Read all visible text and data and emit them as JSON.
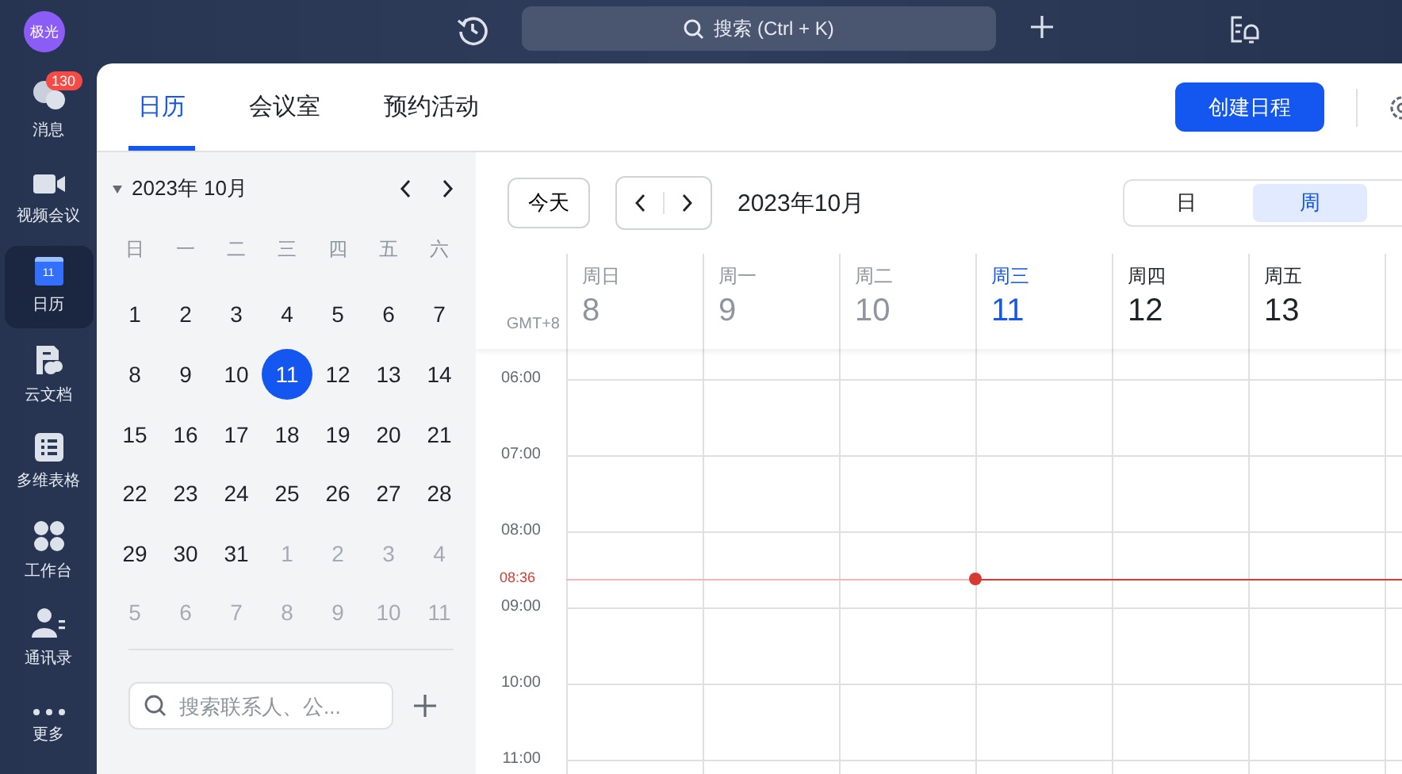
{
  "top_bar": {
    "avatar": "极光",
    "search": {
      "placeholder": "搜索 (Ctrl + K)"
    }
  },
  "rail": [
    {
      "kind": "chat",
      "label": "消息",
      "badge": "130",
      "selected": false
    },
    {
      "kind": "video",
      "label": "视频会议",
      "selected": false
    },
    {
      "kind": "calendar",
      "label": "日历",
      "icon_text": "11",
      "selected": true
    },
    {
      "kind": "doc",
      "label": "云文档",
      "selected": false
    },
    {
      "kind": "sheet",
      "label": "多维表格",
      "selected": false
    },
    {
      "kind": "apps",
      "label": "工作台",
      "selected": false
    },
    {
      "kind": "contacts",
      "label": "通讯录",
      "selected": false
    },
    {
      "kind": "more",
      "label": "更多",
      "selected": false
    }
  ],
  "tabs": [
    {
      "label": "日历",
      "selected": true
    },
    {
      "label": "会议室",
      "selected": false
    },
    {
      "label": "预约活动",
      "selected": false
    }
  ],
  "create_button": "创建日程",
  "mini_calendar": {
    "title": "2023年 10月",
    "weekdays": [
      "日",
      "一",
      "二",
      "三",
      "四",
      "五",
      "六"
    ],
    "weeks": [
      [
        {
          "day": "1",
          "other_month": false,
          "selected": false
        },
        {
          "day": "2",
          "other_month": false,
          "selected": false
        },
        {
          "day": "3",
          "other_month": false,
          "selected": false
        },
        {
          "day": "4",
          "other_month": false,
          "selected": false
        },
        {
          "day": "5",
          "other_month": false,
          "selected": false
        },
        {
          "day": "6",
          "other_month": false,
          "selected": false
        },
        {
          "day": "7",
          "other_month": false,
          "selected": false
        }
      ],
      [
        {
          "day": "8",
          "other_month": false,
          "selected": false
        },
        {
          "day": "9",
          "other_month": false,
          "selected": false
        },
        {
          "day": "10",
          "other_month": false,
          "selected": false
        },
        {
          "day": "11",
          "other_month": false,
          "selected": true
        },
        {
          "day": "12",
          "other_month": false,
          "selected": false
        },
        {
          "day": "13",
          "other_month": false,
          "selected": false
        },
        {
          "day": "14",
          "other_month": false,
          "selected": false
        }
      ],
      [
        {
          "day": "15",
          "other_month": false,
          "selected": false
        },
        {
          "day": "16",
          "other_month": false,
          "selected": false
        },
        {
          "day": "17",
          "other_month": false,
          "selected": false
        },
        {
          "day": "18",
          "other_month": false,
          "selected": false
        },
        {
          "day": "19",
          "other_month": false,
          "selected": false
        },
        {
          "day": "20",
          "other_month": false,
          "selected": false
        },
        {
          "day": "21",
          "other_month": false,
          "selected": false
        }
      ],
      [
        {
          "day": "22",
          "other_month": false,
          "selected": false
        },
        {
          "day": "23",
          "other_month": false,
          "selected": false
        },
        {
          "day": "24",
          "other_month": false,
          "selected": false
        },
        {
          "day": "25",
          "other_month": false,
          "selected": false
        },
        {
          "day": "26",
          "other_month": false,
          "selected": false
        },
        {
          "day": "27",
          "other_month": false,
          "selected": false
        },
        {
          "day": "28",
          "other_month": false,
          "selected": false
        }
      ],
      [
        {
          "day": "29",
          "other_month": false,
          "selected": false
        },
        {
          "day": "30",
          "other_month": false,
          "selected": false
        },
        {
          "day": "31",
          "other_month": false,
          "selected": false
        },
        {
          "day": "1",
          "other_month": true,
          "selected": false
        },
        {
          "day": "2",
          "other_month": true,
          "selected": false
        },
        {
          "day": "3",
          "other_month": true,
          "selected": false
        },
        {
          "day": "4",
          "other_month": true,
          "selected": false
        }
      ],
      [
        {
          "day": "5",
          "other_month": true,
          "selected": false
        },
        {
          "day": "6",
          "other_month": true,
          "selected": false
        },
        {
          "day": "7",
          "other_month": true,
          "selected": false
        },
        {
          "day": "8",
          "other_month": true,
          "selected": false
        },
        {
          "day": "9",
          "other_month": true,
          "selected": false
        },
        {
          "day": "10",
          "other_month": true,
          "selected": false
        },
        {
          "day": "11",
          "other_month": true,
          "selected": false
        }
      ]
    ],
    "contact_search": {
      "placeholder": "搜索联系人、公..."
    }
  },
  "toolbar": {
    "today_button": "今天",
    "title": "2023年10月",
    "views": [
      {
        "label": "日",
        "selected": false
      },
      {
        "label": "周",
        "selected": true
      }
    ]
  },
  "week": {
    "timezone": "GMT+8",
    "days": [
      {
        "weekday": "周日",
        "date": "8",
        "past": true,
        "selected": false
      },
      {
        "weekday": "周一",
        "date": "9",
        "past": true,
        "selected": false
      },
      {
        "weekday": "周二",
        "date": "10",
        "past": true,
        "selected": false
      },
      {
        "weekday": "周三",
        "date": "11",
        "past": false,
        "selected": true
      },
      {
        "weekday": "周四",
        "date": "12",
        "past": false,
        "selected": false
      },
      {
        "weekday": "周五",
        "date": "13",
        "past": false,
        "selected": false
      }
    ],
    "hours": [
      "06:00",
      "07:00",
      "08:00",
      "09:00",
      "10:00",
      "11:00"
    ],
    "now": "08:36"
  }
}
